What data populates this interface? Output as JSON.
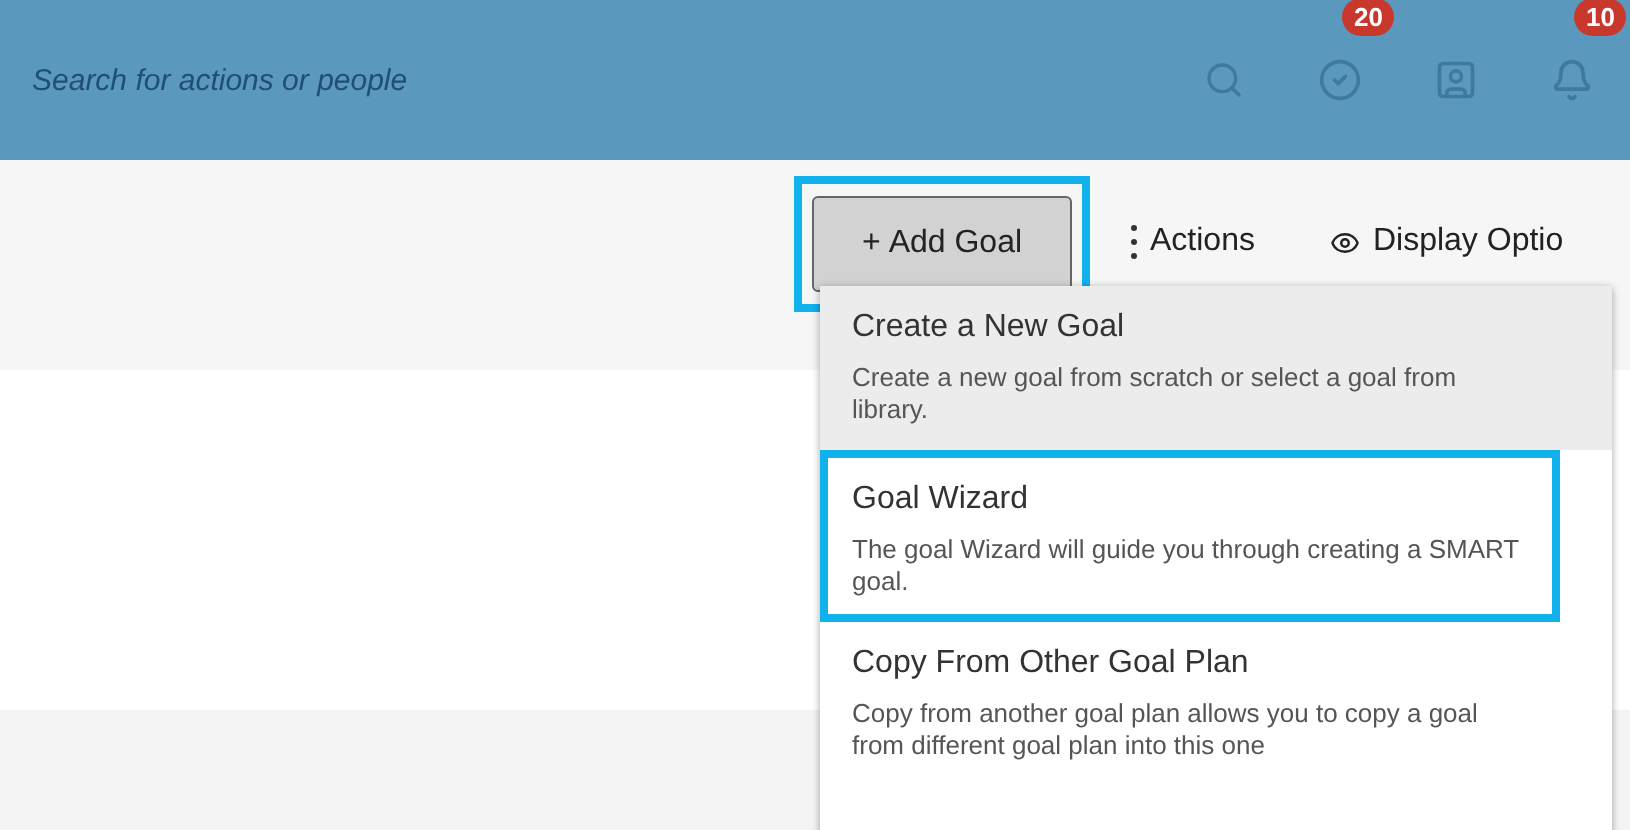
{
  "header": {
    "search": {
      "placeholder": "Search for actions or people"
    },
    "icons": [
      {
        "kind": "search"
      },
      {
        "kind": "check",
        "badge": "20"
      },
      {
        "kind": "contact"
      },
      {
        "kind": "bell",
        "badge": "10"
      }
    ]
  },
  "toolbar": {
    "add_goal": {
      "icon": "+",
      "label": "Add Goal",
      "pressed": true,
      "highlighted": true
    },
    "actions": {
      "label": "Actions"
    },
    "display_options": {
      "label": "Display Optio"
    }
  },
  "menu": {
    "items": [
      {
        "title": "Create a New Goal",
        "description": "Create a new goal from scratch or select a goal from library.",
        "selected": true,
        "highlighted": false
      },
      {
        "title": "Goal Wizard",
        "description": "The goal Wizard will guide you through creating a SMART goal.",
        "selected": false,
        "highlighted": true
      },
      {
        "title": "Copy From Other Goal Plan",
        "description": "Copy from another goal plan allows you to copy a goal from different goal plan into this one",
        "selected": false,
        "highlighted": false
      }
    ]
  }
}
